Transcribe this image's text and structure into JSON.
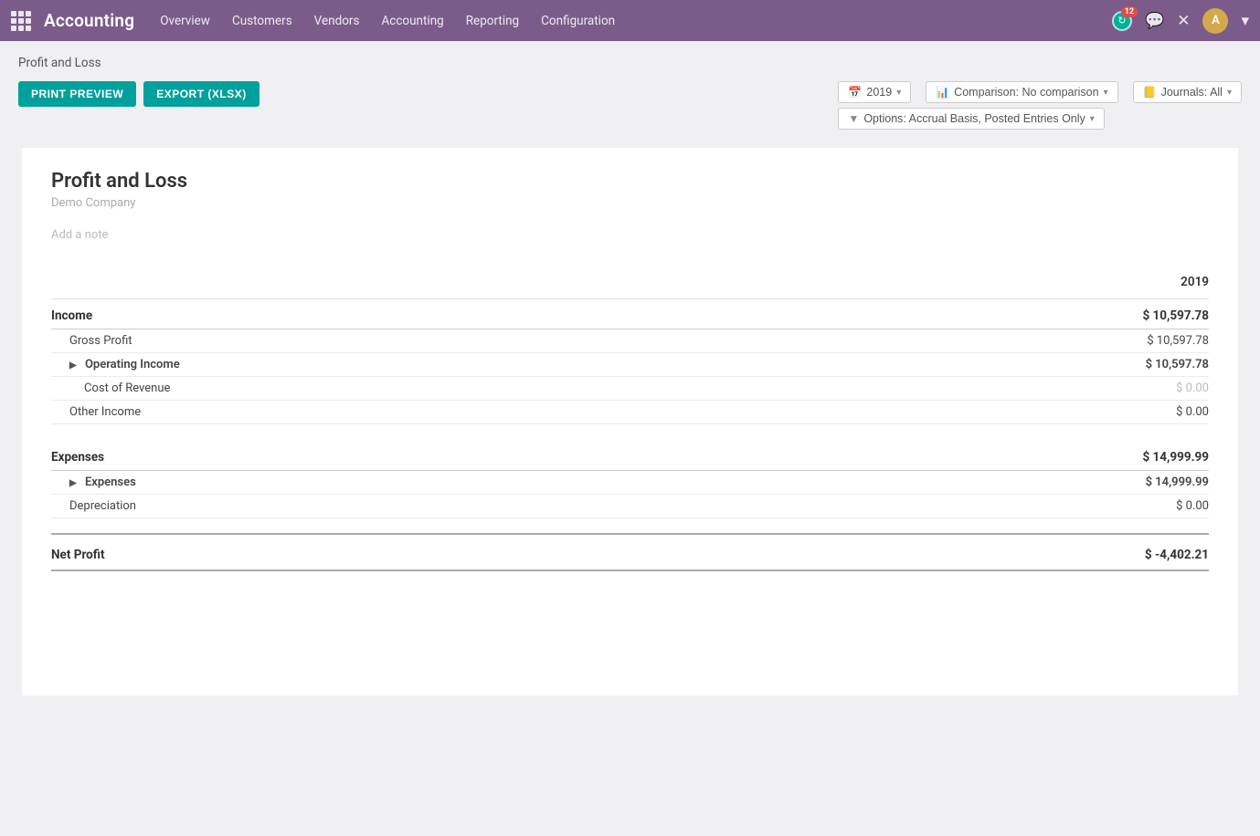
{
  "app": {
    "title": "Accounting",
    "nav_links": [
      "Overview",
      "Customers",
      "Vendors",
      "Accounting",
      "Reporting",
      "Configuration"
    ],
    "badge_count": "12"
  },
  "page": {
    "breadcrumb": "Profit and Loss",
    "print_btn": "PRINT PREVIEW",
    "export_btn": "EXPORT (XLSX)",
    "filters": {
      "year": "2019",
      "comparison": "Comparison: No comparison",
      "journals": "Journals: All",
      "options": "Options: Accrual Basis, Posted Entries Only"
    }
  },
  "report": {
    "title": "Profit and Loss",
    "company": "Demo Company",
    "note_placeholder": "Add a note",
    "year_column": "2019",
    "sections": [
      {
        "name": "income_section",
        "label": "Income",
        "value": "$ 10,597.78",
        "rows": [
          {
            "label": "Gross Profit",
            "value": "$ 10,597.78",
            "indent": 1,
            "expandable": false,
            "muted": false
          },
          {
            "label": "Operating Income",
            "value": "$ 10,597.78",
            "indent": 1,
            "expandable": true,
            "muted": false
          },
          {
            "label": "Cost of Revenue",
            "value": "$ 0.00",
            "indent": 2,
            "expandable": false,
            "muted": true
          },
          {
            "label": "Other Income",
            "value": "$ 0.00",
            "indent": 1,
            "expandable": false,
            "muted": false
          }
        ]
      },
      {
        "name": "expenses_section",
        "label": "Expenses",
        "value": "$ 14,999.99",
        "rows": [
          {
            "label": "Expenses",
            "value": "$ 14,999.99",
            "indent": 1,
            "expandable": true,
            "muted": false
          },
          {
            "label": "Depreciation",
            "value": "$ 0.00",
            "indent": 1,
            "expandable": false,
            "muted": false
          }
        ]
      }
    ],
    "net_profit": {
      "label": "Net Profit",
      "value": "$ -4,402.21"
    }
  }
}
